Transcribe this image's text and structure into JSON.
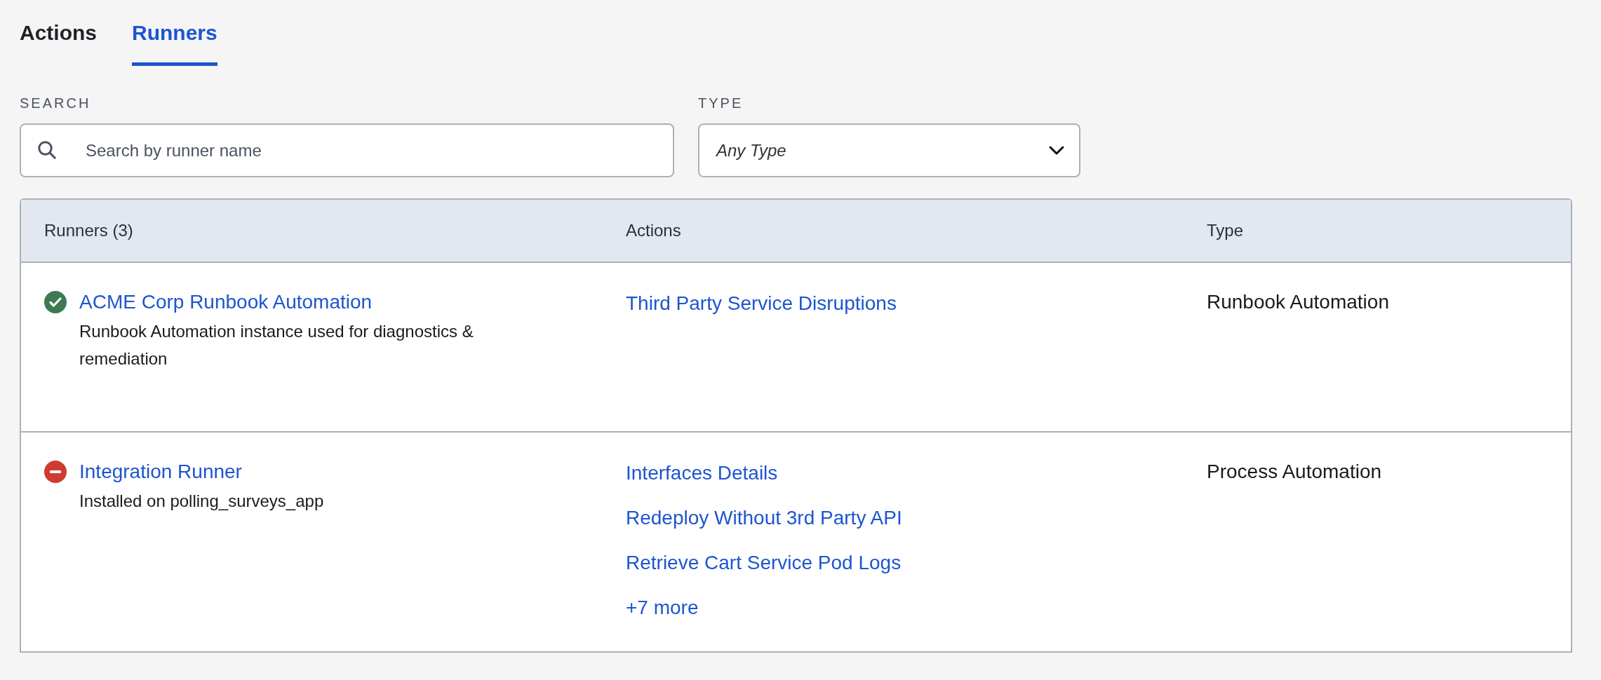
{
  "tabs": [
    {
      "label": "Actions",
      "selected": false
    },
    {
      "label": "Runners",
      "selected": true
    }
  ],
  "search": {
    "label": "SEARCH",
    "placeholder": "Search by runner name"
  },
  "type_filter": {
    "label": "TYPE",
    "value": "Any Type"
  },
  "table": {
    "columns": [
      "Runners (3)",
      "Actions",
      "Type"
    ],
    "rows": [
      {
        "kind": "ok",
        "name": "ACME Corp Runbook Automation",
        "description": "Runbook Automation instance used for diagnostics & remediation",
        "actions": [
          "Third Party Service Disruptions"
        ],
        "type": "Runbook Automation"
      },
      {
        "kind": "error",
        "name": "Integration Runner",
        "description": "Installed on polling_surveys_app",
        "actions": [
          "Interfaces Details",
          "Redeploy Without 3rd Party API",
          "Retrieve Cart Service Pod Logs"
        ],
        "more": "+7 more",
        "type": "Process Automation"
      }
    ]
  }
}
